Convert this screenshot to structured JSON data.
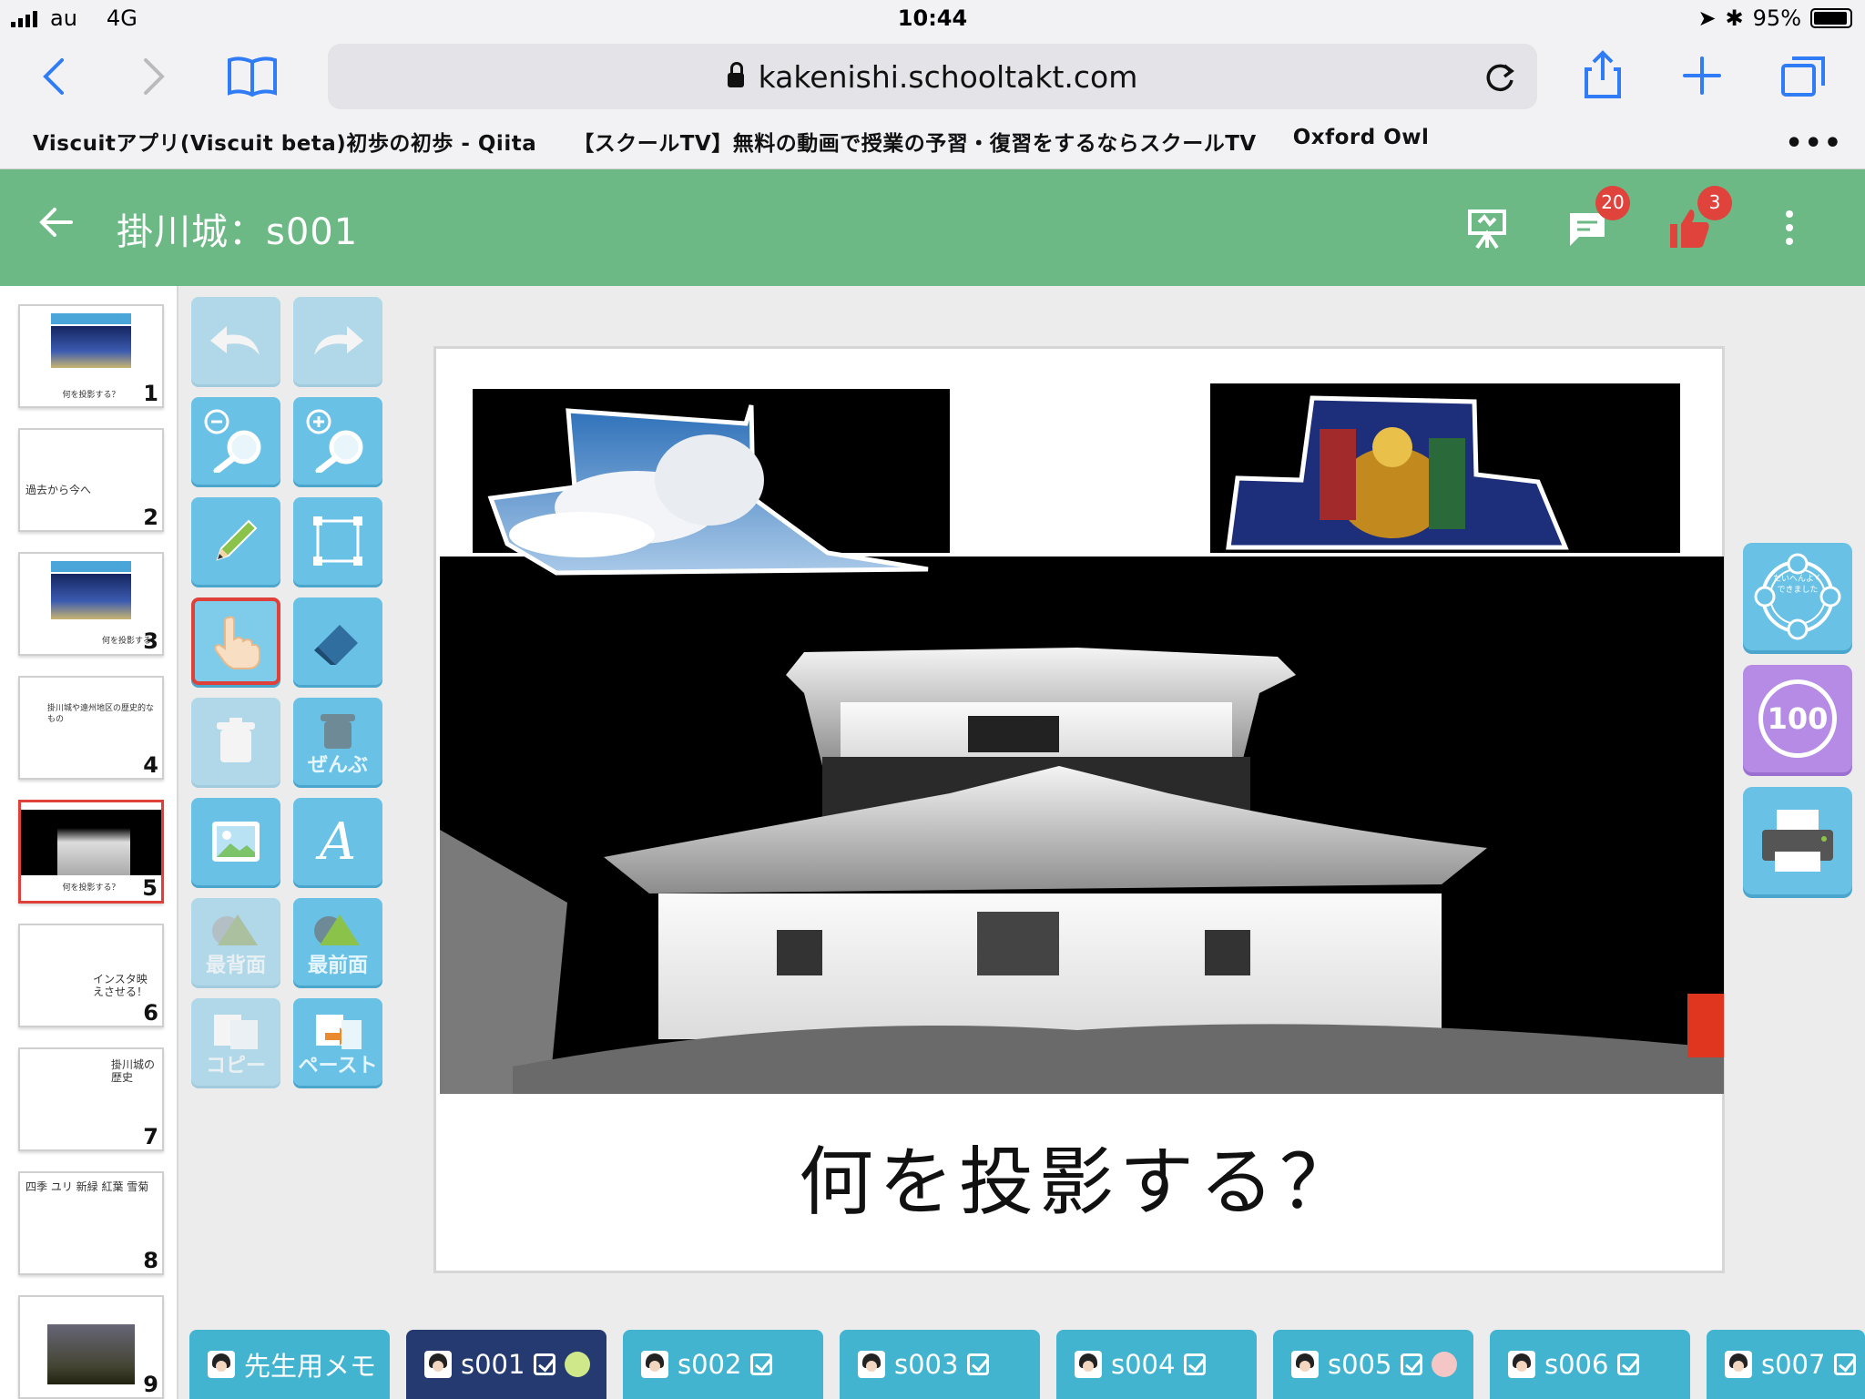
{
  "status_bar": {
    "carrier": "au",
    "network": "4G",
    "time": "10:44",
    "battery": "95%",
    "battery_level": 0.95
  },
  "browser": {
    "url": "kakenishi.schooltakt.com",
    "bookmarks": [
      "Viscuitアプリ(Viscuit beta)初歩の初歩 - Qiita",
      "【スクールTV】無料の動画で授業の予習・復習をするならスクールTV",
      "Oxford Owl"
    ],
    "more": "•••"
  },
  "app": {
    "title": "掛川城：s001",
    "comment_count": "20",
    "like_count": "3",
    "colors": {
      "header": "#6cb985",
      "badge": "#e0433c",
      "tool": "#69c1e6",
      "tab": "#43b4cf",
      "tab_selected": "#263a72"
    }
  },
  "thumbnails": [
    {
      "num": "1",
      "caption": "何を投影する？"
    },
    {
      "num": "2",
      "caption": "過去から今へ"
    },
    {
      "num": "3",
      "caption": "何を投影する"
    },
    {
      "num": "4",
      "caption": "掛川城や遠州地区の歴史的なもの"
    },
    {
      "num": "5",
      "caption": "何を投影する？"
    },
    {
      "num": "6",
      "caption": "インスタ映えさせる！"
    },
    {
      "num": "7",
      "caption": "掛川城の歴史"
    },
    {
      "num": "8",
      "caption": "四季 ユリ 新緑 紅葉 雪菊"
    },
    {
      "num": "9",
      "caption": ""
    }
  ],
  "tools": {
    "delete_all": "ぜんぶ",
    "send_back": "最背面",
    "bring_front": "最前面",
    "copy": "コピー",
    "paste": "ペースト"
  },
  "slide": {
    "title": "何を投影する？"
  },
  "side": {
    "stamp_text": "たいへんよくできました",
    "score": "100"
  },
  "tabs": [
    {
      "label": "先生用メモ"
    },
    {
      "label": "s001"
    },
    {
      "label": "s002"
    },
    {
      "label": "s003"
    },
    {
      "label": "s004"
    },
    {
      "label": "s005"
    },
    {
      "label": "s006"
    },
    {
      "label": "s007"
    }
  ]
}
